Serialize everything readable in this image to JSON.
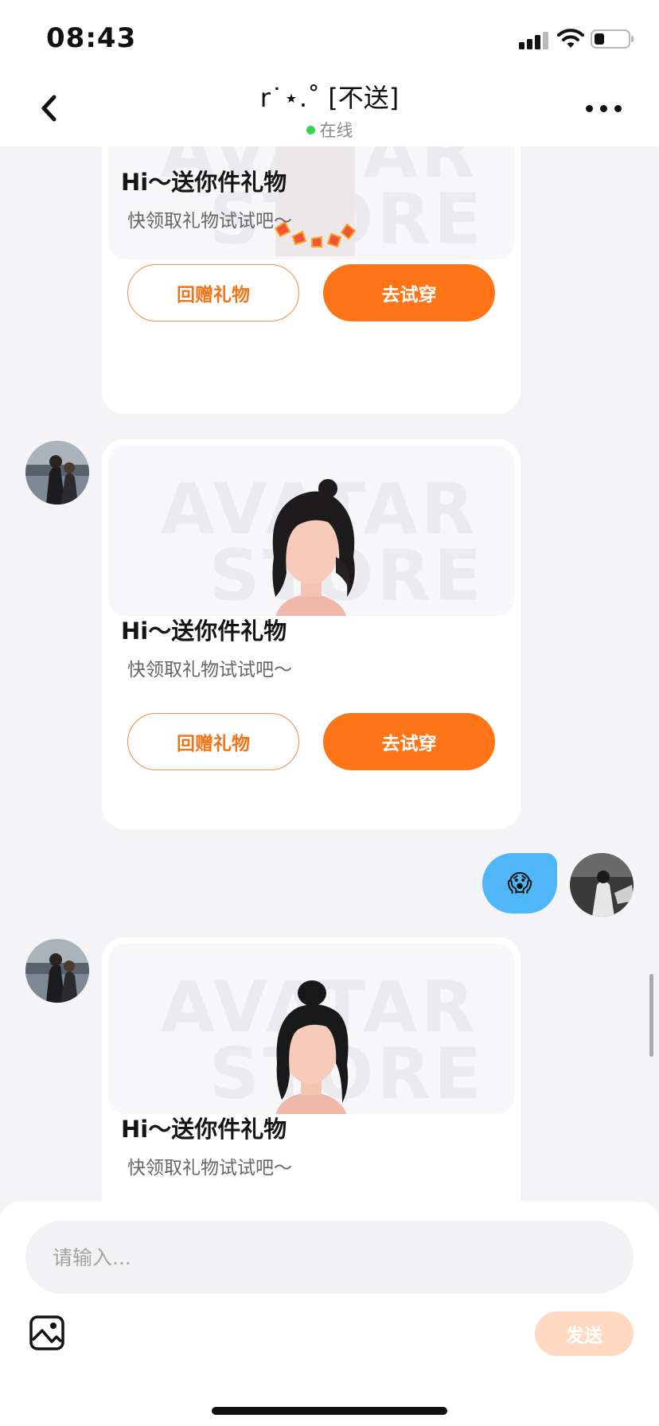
{
  "status_bar": {
    "time": "08:43"
  },
  "header": {
    "title": "r˙⋆.˚ [不送]",
    "status": "在线"
  },
  "messages": [
    {
      "type": "gift",
      "title": "Hi～送你件礼物",
      "subtitle": "快领取礼物试试吧～",
      "return_label": "回赠礼物",
      "try_label": "去试穿"
    },
    {
      "type": "gift",
      "title": "Hi～送你件礼物",
      "subtitle": "快领取礼物试试吧～",
      "return_label": "回赠礼物",
      "try_label": "去试穿"
    },
    {
      "type": "emoji",
      "content": "😱"
    },
    {
      "type": "gift",
      "title": "Hi～送你件礼物",
      "subtitle": "快领取礼物试试吧～"
    }
  ],
  "input": {
    "placeholder": "请输入...",
    "send_label": "发送"
  },
  "colors": {
    "accent": "#ff7417",
    "bubble": "#4fb6f8",
    "online": "#35d34b",
    "send_disabled": "#ffd9c2"
  }
}
